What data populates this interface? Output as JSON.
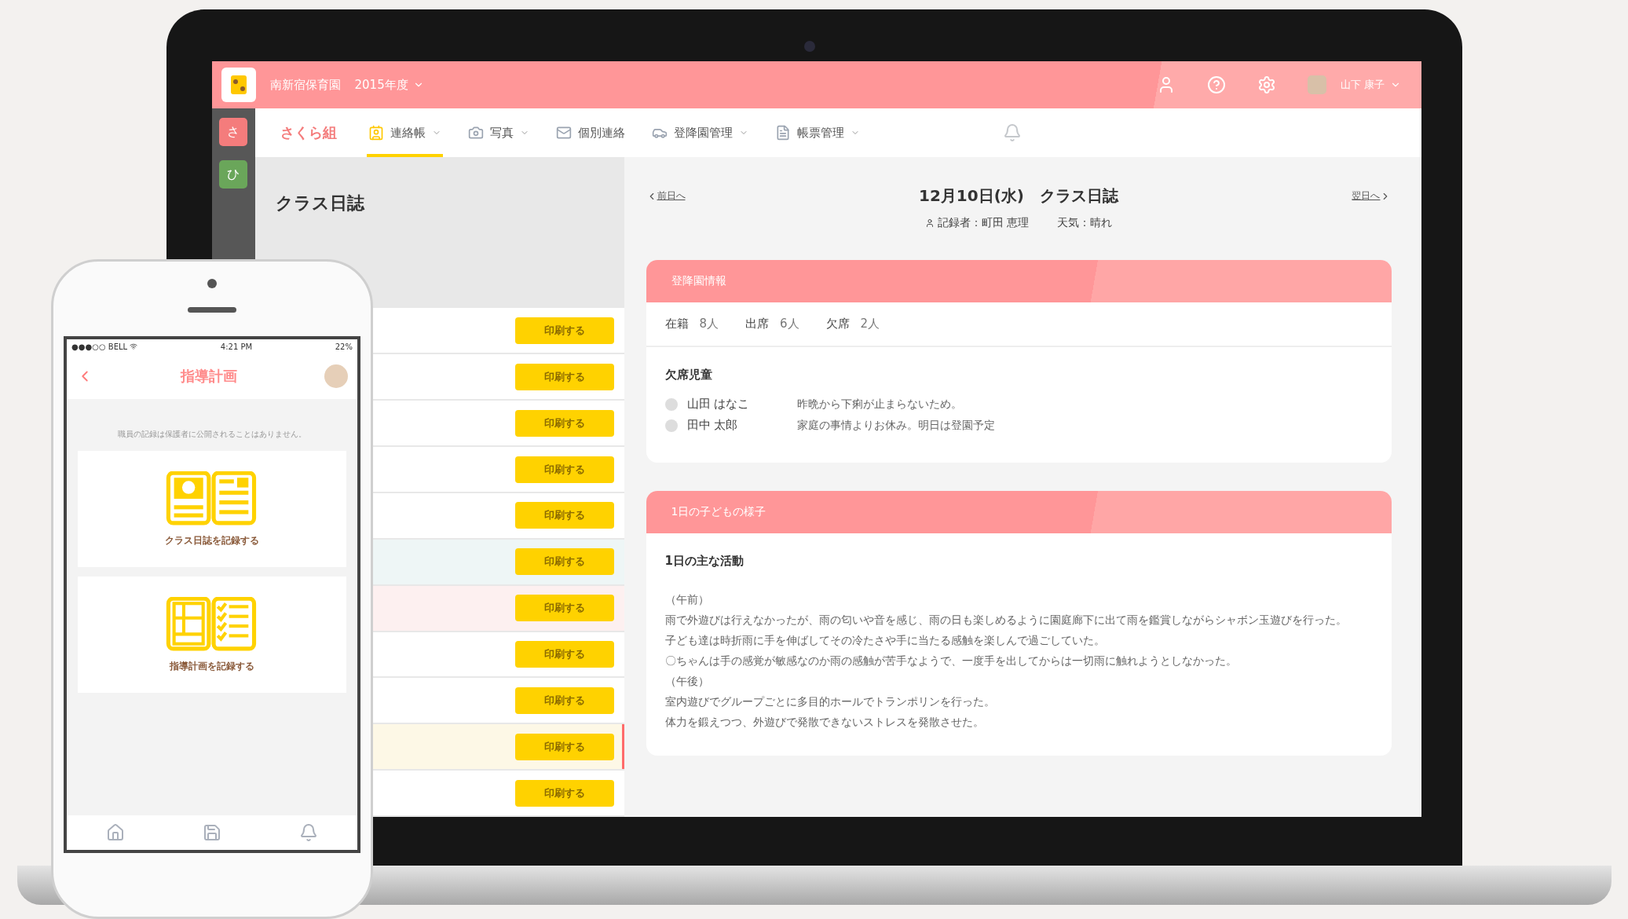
{
  "laptop": {
    "header": {
      "school": "南新宿保育園",
      "year": "2015年度",
      "user": "山下 康子"
    },
    "rail": [
      {
        "label": "さ",
        "color": "#f47c7c"
      },
      {
        "label": "ひ",
        "color": "#6aa65a"
      }
    ],
    "nav": {
      "class_name": "さくら組",
      "items": [
        {
          "label": "連絡帳",
          "selected": true
        },
        {
          "label": "写真",
          "selected": false
        },
        {
          "label": "個別連絡",
          "selected": false
        },
        {
          "label": "登降園管理",
          "selected": false
        },
        {
          "label": "帳票管理",
          "selected": false
        }
      ]
    },
    "list": {
      "title": "クラス日誌",
      "rows": [
        {
          "button": "印刷する",
          "color": "#ffffff",
          "selected": false
        },
        {
          "button": "印刷する",
          "color": "#ffffff",
          "selected": false
        },
        {
          "button": "印刷する",
          "color": "#ffffff",
          "selected": false
        },
        {
          "button": "印刷する",
          "color": "#ffffff",
          "selected": false
        },
        {
          "button": "印刷する",
          "color": "#ffffff",
          "selected": false
        },
        {
          "button": "印刷する",
          "color": "#eef6f6",
          "selected": false
        },
        {
          "button": "印刷する",
          "color": "#fdf0f0",
          "selected": false
        },
        {
          "button": "印刷する",
          "color": "#ffffff",
          "selected": false
        },
        {
          "button": "印刷する",
          "color": "#ffffff",
          "selected": false
        },
        {
          "button": "印刷する",
          "color": "#fdf8e6",
          "selected": true
        },
        {
          "button": "印刷する",
          "color": "#ffffff",
          "selected": false
        }
      ]
    },
    "diary": {
      "prev": "前日へ",
      "title": "12月10日(水)　クラス日誌",
      "next": "翌日へ",
      "recorder": "記録者：町田 恵理",
      "weather": "天気：晴れ",
      "attendance": {
        "heading": "登降園情報",
        "stats": [
          {
            "label": "在籍",
            "value": "8人"
          },
          {
            "label": "出席",
            "value": "6人"
          },
          {
            "label": "欠席",
            "value": "2人"
          }
        ],
        "absent_heading": "欠席児童",
        "absent": [
          {
            "name": "山田 はなこ",
            "reason": "昨晩から下痢が止まらないため。"
          },
          {
            "name": "田中 太郎",
            "reason": "家庭の事情よりお休み。明日は登園予定"
          }
        ]
      },
      "children": {
        "heading": "1日の子どもの様子",
        "subheading": "1日の主な活動",
        "lines": [
          "（午前）",
          "雨で外遊びは行えなかったが、雨の匂いや音を感じ、雨の日も楽しめるように園庭廊下に出て雨を鑑賞しながらシャボン玉遊びを行った。",
          "子ども達は時折雨に手を伸ばしてその冷たさや手に当たる感触を楽しんで過ごしていた。",
          "〇ちゃんは手の感覚が敏感なのか雨の感触が苦手なようで、一度手を出してからは一切雨に触れようとしなかった。",
          "（午後）",
          "室内遊びでグループごとに多目的ホールでトランポリンを行った。",
          "体力を鍛えつつ、外遊びで発散できないストレスを発散させた。"
        ]
      }
    }
  },
  "phone": {
    "status": {
      "carrier": "●●●○○ BELL",
      "time": "4:21 PM",
      "battery": "22%"
    },
    "title": "指導計画",
    "note": "職員の記録は保護者に公開されることはありません。",
    "cards": [
      {
        "kind": "diary",
        "label": "クラス日誌を記録する"
      },
      {
        "kind": "plan",
        "label": "指導計画を記録する"
      }
    ]
  }
}
